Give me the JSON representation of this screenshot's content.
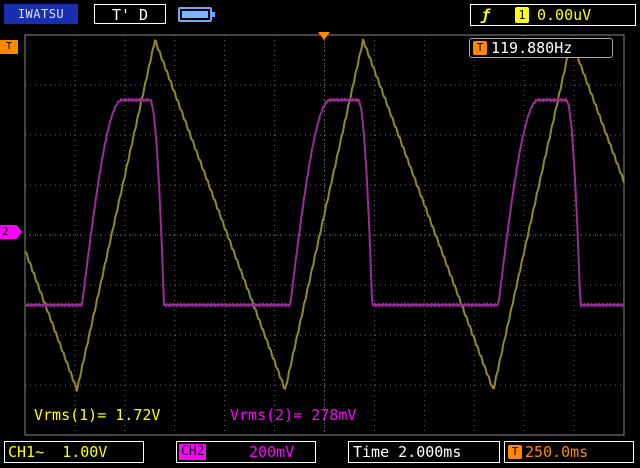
{
  "header": {
    "brand": "IWATSU",
    "trigger_state": "T' D",
    "trigger_edge_icon": "rising-edge-icon",
    "trigger_source": "1",
    "trigger_level": "0.00uV"
  },
  "display": {
    "trigger_marker": "T",
    "ch2_marker": "2",
    "frequency_icon": "T",
    "frequency": "119.880Hz",
    "measurements": [
      {
        "label": "Vrms(1)=",
        "value": "1.72V"
      },
      {
        "label": "Vrms(2)=",
        "value": "278mV"
      }
    ]
  },
  "footer": {
    "ch1_label": "CH1~",
    "ch1_scale": "1.00V",
    "ch2_label": "CH2",
    "ch2_scale": "200mV",
    "timebase_label": "Time",
    "timebase_value": "2.000ms",
    "trigger_delay_icon": "T→",
    "trigger_delay": "250.0ms"
  },
  "colors": {
    "ch1": "#ffff00",
    "ch1_trace": "#8f8a2a",
    "ch2": "#ff00ff",
    "ch2_trace": "#9b2a9b",
    "trigger": "#ff8800",
    "grid": "#666666"
  },
  "traces": {
    "ch1": {
      "name": "CH1",
      "shape": "sawtooth",
      "period_ms": 8.34,
      "min_div": -3.1,
      "max_div": 3.9
    },
    "ch2": {
      "name": "CH2",
      "shape": "rounded-pulse",
      "period_ms": 8.34,
      "low_div": -1.4,
      "high_div": 2.7
    }
  }
}
